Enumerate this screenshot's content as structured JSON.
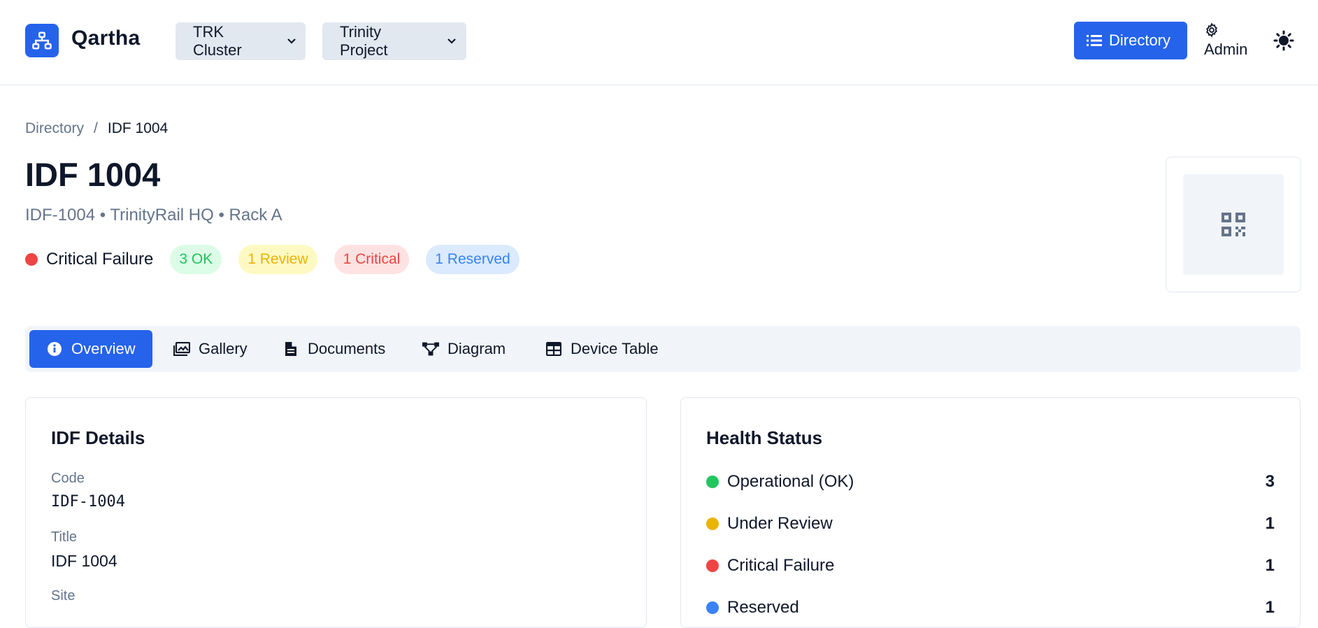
{
  "app": {
    "name": "Qartha"
  },
  "header": {
    "cluster_select": "TRK Cluster",
    "project_select": "Trinity Project",
    "directory_button": "Directory",
    "admin_label": "Admin"
  },
  "breadcrumb": {
    "root": "Directory",
    "separator": "/",
    "current": "IDF 1004"
  },
  "idf": {
    "title": "IDF 1004",
    "subtitle": "IDF-1004 • TrinityRail HQ • Rack A",
    "status": "Critical Failure",
    "status_color": "#ef4444",
    "pills": {
      "ok": "3 OK",
      "review": "1 Review",
      "critical": "1 Critical",
      "reserved": "1 Reserved"
    }
  },
  "tabs": [
    {
      "label": "Overview",
      "icon": "info-icon",
      "active": true
    },
    {
      "label": "Gallery",
      "icon": "gallery-icon"
    },
    {
      "label": "Documents",
      "icon": "document-icon"
    },
    {
      "label": "Diagram",
      "icon": "diagram-icon"
    },
    {
      "label": "Device Table",
      "icon": "table-icon"
    }
  ],
  "details": {
    "title": "IDF Details",
    "code_label": "Code",
    "code_value": "IDF-1004",
    "title_label": "Title",
    "title_value": "IDF 1004",
    "site_label": "Site"
  },
  "health": {
    "title": "Health Status",
    "rows": [
      {
        "label": "Operational (OK)",
        "count": "3",
        "color": "#22c55e"
      },
      {
        "label": "Under Review",
        "count": "1",
        "color": "#eab308"
      },
      {
        "label": "Critical Failure",
        "count": "1",
        "color": "#ef4444"
      },
      {
        "label": "Reserved",
        "count": "1",
        "color": "#3b82f6"
      }
    ]
  },
  "colors": {
    "accent": "#2563eb"
  }
}
